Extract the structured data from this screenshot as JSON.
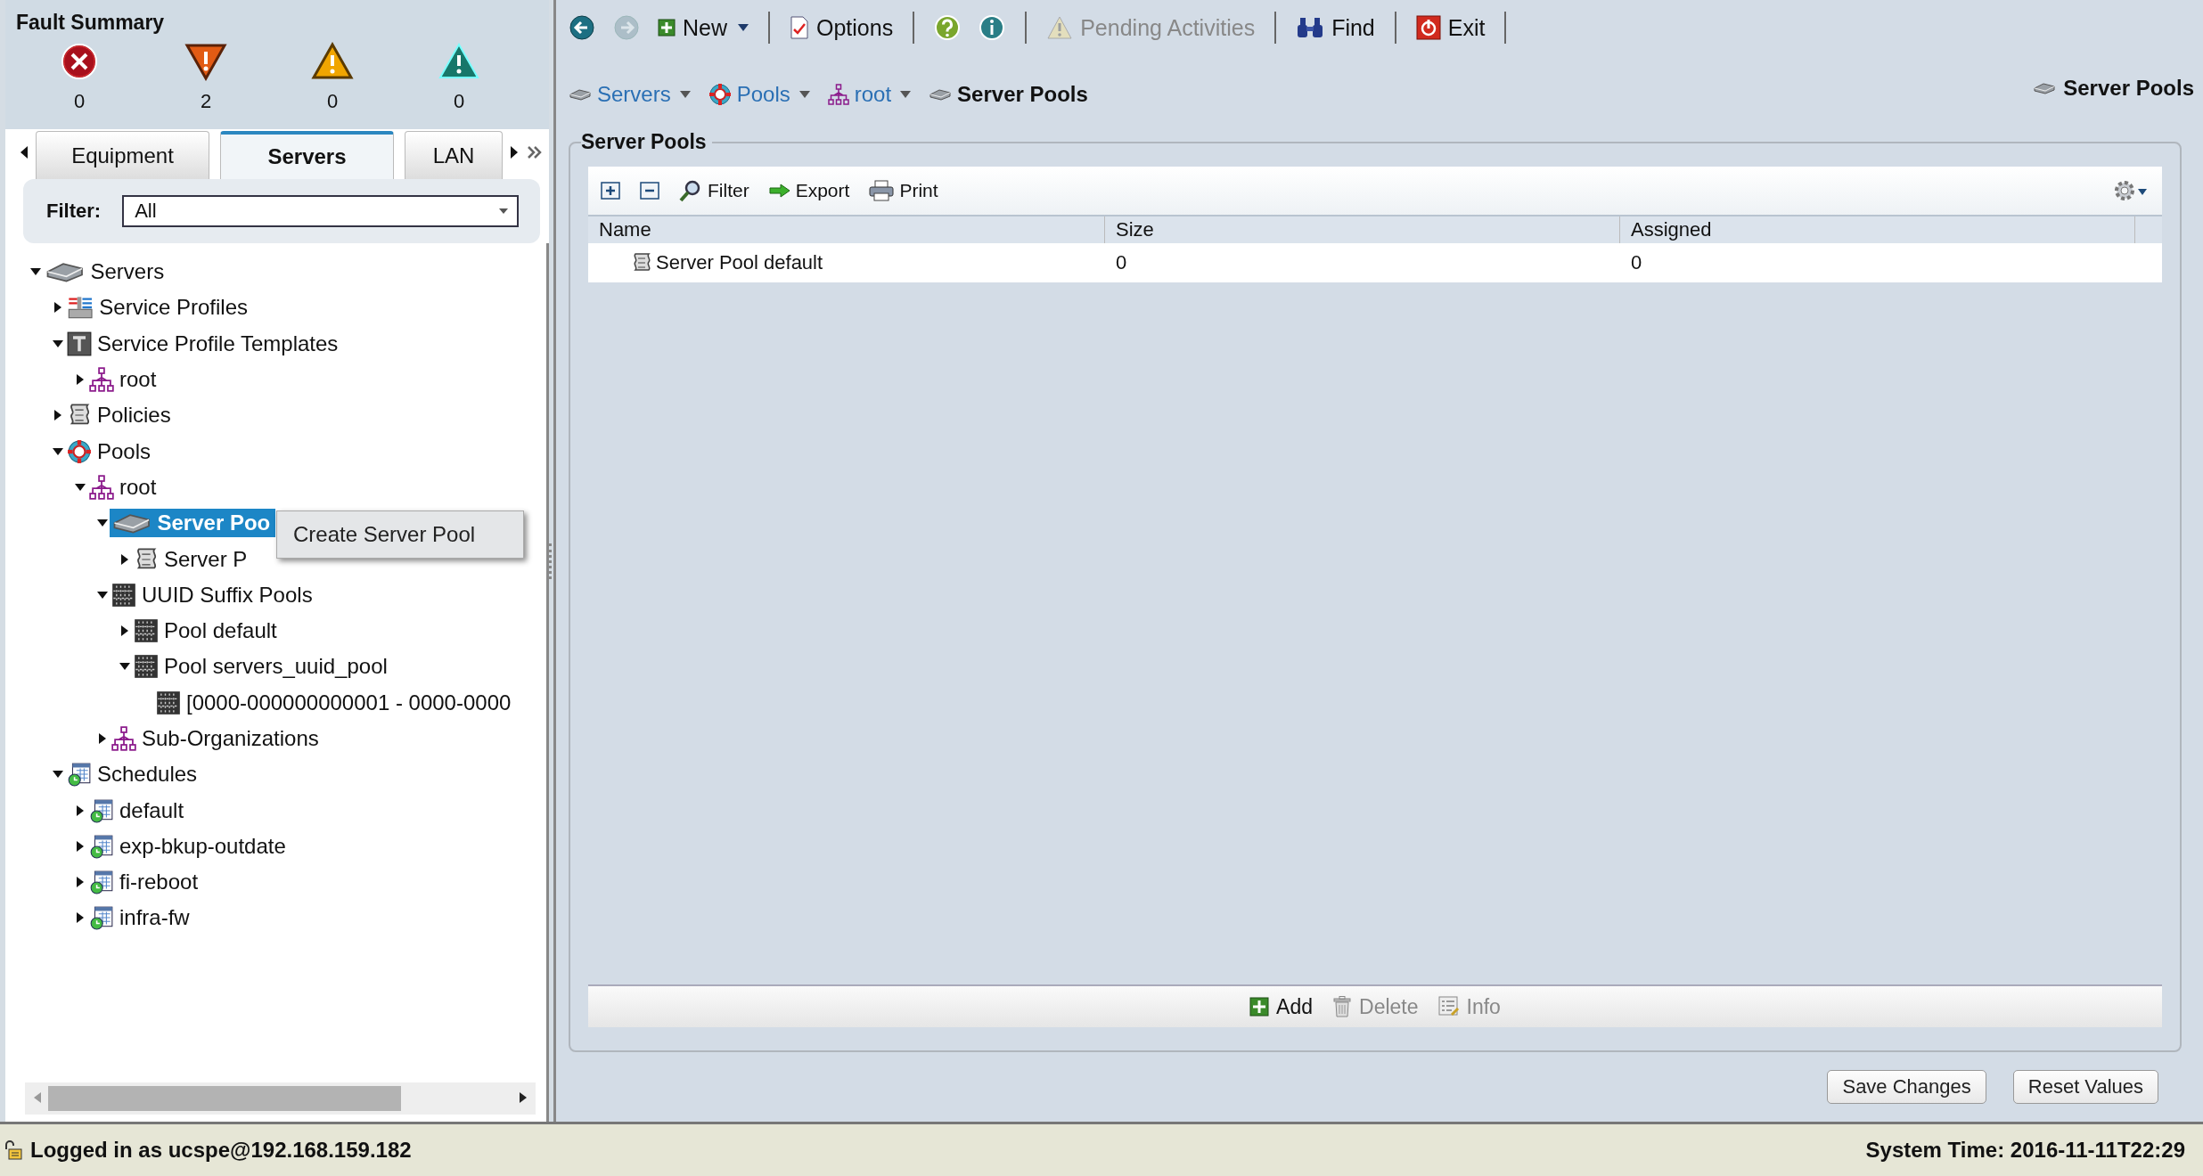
{
  "fault_summary": {
    "title": "Fault Summary",
    "items": [
      {
        "kind": "critical",
        "count": "0"
      },
      {
        "kind": "major",
        "count": "2"
      },
      {
        "kind": "minor",
        "count": "0"
      },
      {
        "kind": "warning",
        "count": "0"
      }
    ]
  },
  "nav_tabs": [
    {
      "label": "Equipment",
      "selected": false
    },
    {
      "label": "Servers",
      "selected": true
    },
    {
      "label": "LAN",
      "selected": false
    }
  ],
  "filter": {
    "label": "Filter:",
    "value": "All"
  },
  "tree": [
    {
      "label": "Servers",
      "kind": "server",
      "expanded": true,
      "selected": false,
      "children": [
        {
          "label": "Service Profiles",
          "kind": "profiles",
          "expanded": false,
          "selected": false
        },
        {
          "label": "Service Profile Templates",
          "kind": "template",
          "expanded": true,
          "selected": false,
          "children": [
            {
              "label": "root",
              "kind": "org",
              "expanded": false,
              "selected": false
            }
          ]
        },
        {
          "label": "Policies",
          "kind": "policy",
          "expanded": false,
          "selected": false
        },
        {
          "label": "Pools",
          "kind": "pools",
          "expanded": true,
          "selected": false,
          "children": [
            {
              "label": "root",
              "kind": "org",
              "expanded": true,
              "selected": false,
              "children": [
                {
                  "label": "Server Poo",
                  "kind": "server",
                  "expanded": true,
                  "selected": true,
                  "children": [
                    {
                      "label": "Server P",
                      "kind": "policy",
                      "expanded": false,
                      "selected": false
                    }
                  ]
                },
                {
                  "label": "UUID Suffix Pools",
                  "kind": "uuid",
                  "expanded": true,
                  "selected": false,
                  "children": [
                    {
                      "label": "Pool default",
                      "kind": "uuid",
                      "expanded": false,
                      "selected": false
                    },
                    {
                      "label": "Pool servers_uuid_pool",
                      "kind": "uuid",
                      "expanded": true,
                      "selected": false,
                      "children": [
                        {
                          "label": "[0000-000000000001 - 0000-0000",
                          "kind": "uuid",
                          "selected": false
                        }
                      ]
                    }
                  ]
                },
                {
                  "label": "Sub-Organizations",
                  "kind": "org",
                  "expanded": false,
                  "selected": false
                }
              ]
            }
          ]
        },
        {
          "label": "Schedules",
          "kind": "schedule",
          "expanded": true,
          "selected": false,
          "children": [
            {
              "label": "default",
              "kind": "schedule",
              "expanded": false,
              "selected": false
            },
            {
              "label": "exp-bkup-outdate",
              "kind": "schedule",
              "expanded": false,
              "selected": false
            },
            {
              "label": "fi-reboot",
              "kind": "schedule",
              "expanded": false,
              "selected": false
            },
            {
              "label": "infra-fw",
              "kind": "schedule",
              "expanded": false,
              "selected": false
            }
          ]
        }
      ]
    }
  ],
  "context_menu": {
    "items": [
      {
        "label": "Create Server Pool"
      }
    ]
  },
  "toolbar": [
    {
      "kind": "back",
      "disabled": false
    },
    {
      "kind": "forward",
      "disabled": true
    },
    {
      "kind": "new",
      "label": "New",
      "disabled": false
    },
    {
      "kind": "options",
      "label": "Options",
      "disabled": false
    },
    {
      "kind": "help",
      "disabled": false
    },
    {
      "kind": "info",
      "disabled": false
    },
    {
      "kind": "pending",
      "label": "Pending Activities",
      "disabled": true
    },
    {
      "kind": "find",
      "label": "Find",
      "disabled": false
    },
    {
      "kind": "exit",
      "label": "Exit",
      "disabled": false
    }
  ],
  "breadcrumb": [
    {
      "label": "Servers",
      "kind": "server",
      "dropdown": true
    },
    {
      "label": "Pools",
      "kind": "pools",
      "dropdown": true
    },
    {
      "label": "root",
      "kind": "org",
      "dropdown": true
    },
    {
      "label": "Server Pools",
      "kind": "server",
      "dropdown": false
    }
  ],
  "page_title": "Server Pools",
  "section": {
    "title": "Server Pools",
    "table_tools": [
      {
        "kind": "expand"
      },
      {
        "kind": "collapse"
      },
      {
        "kind": "filter",
        "label": "Filter"
      },
      {
        "kind": "export",
        "label": "Export"
      },
      {
        "kind": "print",
        "label": "Print"
      }
    ],
    "table": {
      "columns": [
        "Name",
        "Size",
        "Assigned"
      ],
      "rows": [
        {
          "cells": [
            "Server Pool default",
            "0",
            "0"
          ]
        }
      ]
    },
    "actions": [
      {
        "kind": "add",
        "label": "Add",
        "disabled": false
      },
      {
        "kind": "delete",
        "label": "Delete",
        "disabled": true
      },
      {
        "kind": "info",
        "label": "Info",
        "disabled": true
      }
    ]
  },
  "buttons": [
    {
      "label": "Save Changes"
    },
    {
      "label": "Reset Values"
    }
  ],
  "status_bar": {
    "login": "Logged in as ucspe@192.168.159.182",
    "time": "System Time: 2016-11-11T22:29"
  }
}
